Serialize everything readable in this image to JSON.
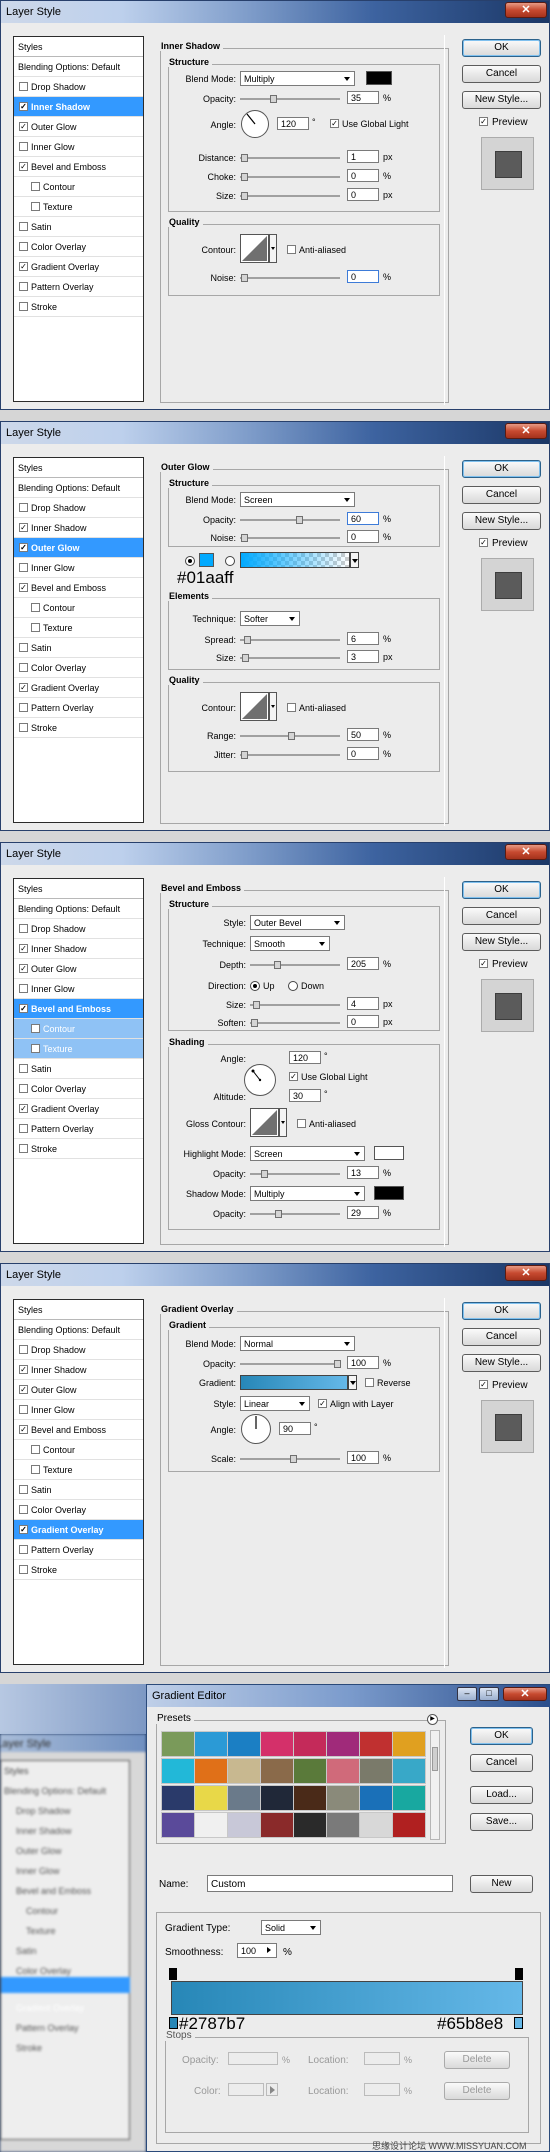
{
  "shared": {
    "title": "Layer Style",
    "close": "✕",
    "ok": "OK",
    "cancel": "Cancel",
    "new_style": "New Style...",
    "preview": "Preview",
    "styles_header": "Styles",
    "blending": "Blending Options: Default",
    "items": [
      "Drop Shadow",
      "Inner Shadow",
      "Outer Glow",
      "Inner Glow",
      "Bevel and Emboss",
      "Contour",
      "Texture",
      "Satin",
      "Color Overlay",
      "Gradient Overlay",
      "Pattern Overlay",
      "Stroke"
    ],
    "check": "✓"
  },
  "inner_shadow": {
    "title": "Inner Shadow",
    "structure": "Structure",
    "blend_label": "Blend Mode:",
    "blend": "Multiply",
    "opacity_label": "Opacity:",
    "opacity": "35",
    "angle_label": "Angle:",
    "angle": "120",
    "deg": "°",
    "global": "Use Global Light",
    "distance_label": "Distance:",
    "distance": "1",
    "choke_label": "Choke:",
    "choke": "0",
    "size_label": "Size:",
    "size": "0",
    "quality": "Quality",
    "contour_label": "Contour:",
    "anti": "Anti-aliased",
    "noise_label": "Noise:",
    "noise": "0",
    "pct": "%",
    "px": "px"
  },
  "outer_glow": {
    "title": "Outer Glow",
    "structure": "Structure",
    "blend_label": "Blend Mode:",
    "blend": "Screen",
    "opacity_label": "Opacity:",
    "opacity": "60",
    "noise_label": "Noise:",
    "noise": "0",
    "color_note": "#01aaff",
    "elements": "Elements",
    "technique_label": "Technique:",
    "technique": "Softer",
    "spread_label": "Spread:",
    "spread": "6",
    "size_label": "Size:",
    "size": "3",
    "quality": "Quality",
    "contour_label": "Contour:",
    "anti": "Anti-aliased",
    "range_label": "Range:",
    "range": "50",
    "jitter_label": "Jitter:",
    "jitter": "0",
    "pct": "%",
    "px": "px"
  },
  "bevel": {
    "title": "Bevel and Emboss",
    "structure": "Structure",
    "style_label": "Style:",
    "style": "Outer Bevel",
    "technique_label": "Technique:",
    "technique": "Smooth",
    "depth_label": "Depth:",
    "depth": "205",
    "direction_label": "Direction:",
    "up": "Up",
    "down": "Down",
    "size_label": "Size:",
    "size": "4",
    "soften_label": "Soften:",
    "soften": "0",
    "shading": "Shading",
    "angle_label": "Angle:",
    "angle": "120",
    "deg": "°",
    "global": "Use Global Light",
    "altitude_label": "Altitude:",
    "altitude": "30",
    "gloss_label": "Gloss Contour:",
    "anti": "Anti-aliased",
    "hl_label": "Highlight Mode:",
    "hl": "Screen",
    "hl_op_label": "Opacity:",
    "hl_op": "13",
    "sh_label": "Shadow Mode:",
    "sh": "Multiply",
    "sh_op_label": "Opacity:",
    "sh_op": "29",
    "pct": "%",
    "px": "px"
  },
  "gradient": {
    "title": "Gradient Overlay",
    "section": "Gradient",
    "blend_label": "Blend Mode:",
    "blend": "Normal",
    "opacity_label": "Opacity:",
    "opacity": "100",
    "gradient_label": "Gradient:",
    "reverse": "Reverse",
    "style_label": "Style:",
    "style": "Linear",
    "align": "Align with Layer",
    "angle_label": "Angle:",
    "angle": "90",
    "deg": "°",
    "scale_label": "Scale:",
    "scale": "100",
    "pct": "%"
  },
  "editor": {
    "title": "Gradient Editor",
    "presets": "Presets",
    "ok": "OK",
    "cancel": "Cancel",
    "load": "Load...",
    "save": "Save...",
    "name_label": "Name:",
    "name": "Custom",
    "new": "New",
    "type_label": "Gradient Type:",
    "type": "Solid",
    "smooth_label": "Smoothness:",
    "smooth": "100",
    "pct": "%",
    "stop_left": "#2787b7",
    "stop_right": "#65b8e8",
    "stops": "Stops",
    "opacity_label": "Opacity:",
    "location_label": "Location:",
    "color_label": "Color:",
    "delete": "Delete",
    "watermark": "思缘设计论坛  WWW.MISSYUAN.COM"
  },
  "colors": {
    "selected": "#3399ff",
    "glow": "#01aaff",
    "grad_left": "#2787b7",
    "grad_right": "#65b8e8"
  }
}
